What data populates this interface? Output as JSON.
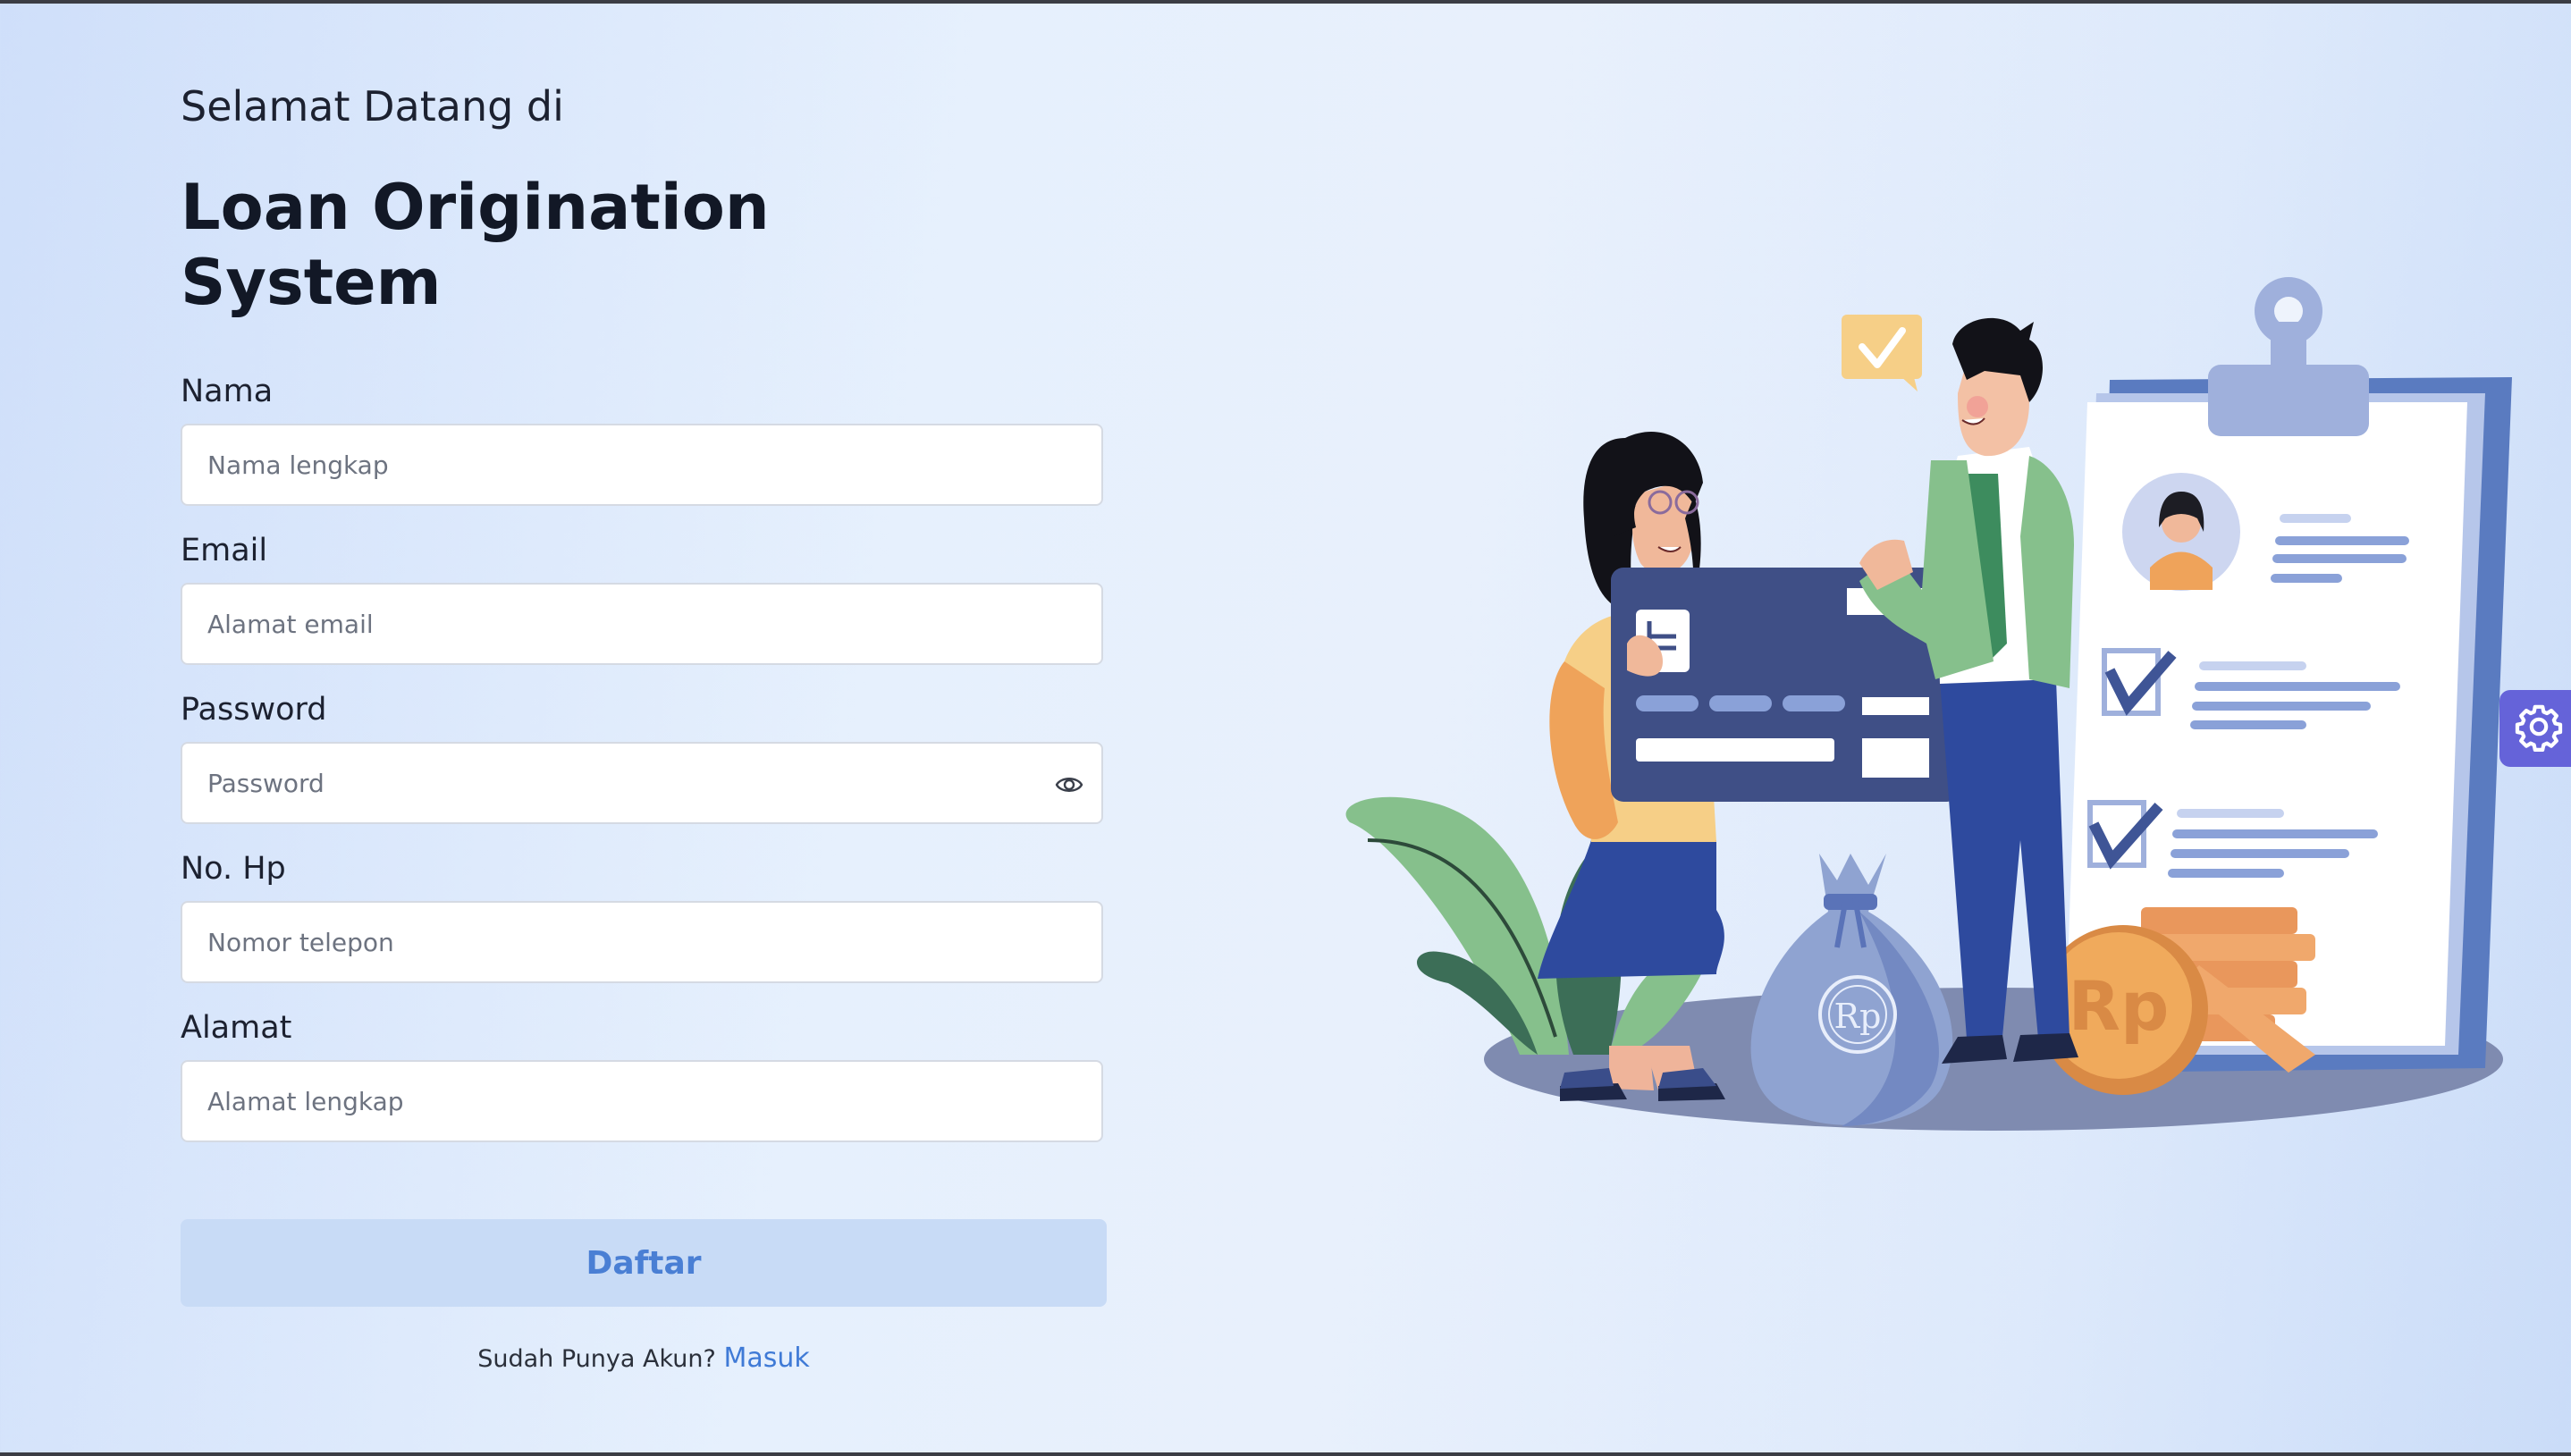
{
  "header": {
    "welcome": "Selamat Datang di",
    "title": "Loan Origination System"
  },
  "form": {
    "fields": [
      {
        "label": "Nama",
        "placeholder": "Nama lengkap"
      },
      {
        "label": "Email",
        "placeholder": "Alamat email"
      },
      {
        "label": "Password",
        "placeholder": "Password"
      },
      {
        "label": "No. Hp",
        "placeholder": "Nomor telepon"
      },
      {
        "label": "Alamat",
        "placeholder": "Alamat lengkap"
      }
    ],
    "submit_label": "Daftar",
    "login_prompt": "Sudah Punya Akun?",
    "login_link": "Masuk"
  },
  "illustration": {
    "coin_text": "Rp",
    "bag_text": "Rp"
  },
  "icons": {
    "password_toggle": "eye-icon",
    "settings": "gear-icon"
  },
  "colors": {
    "accent": "#3f7ad6",
    "button_bg": "#c8dbf6",
    "settings_tab": "#6563d9"
  }
}
